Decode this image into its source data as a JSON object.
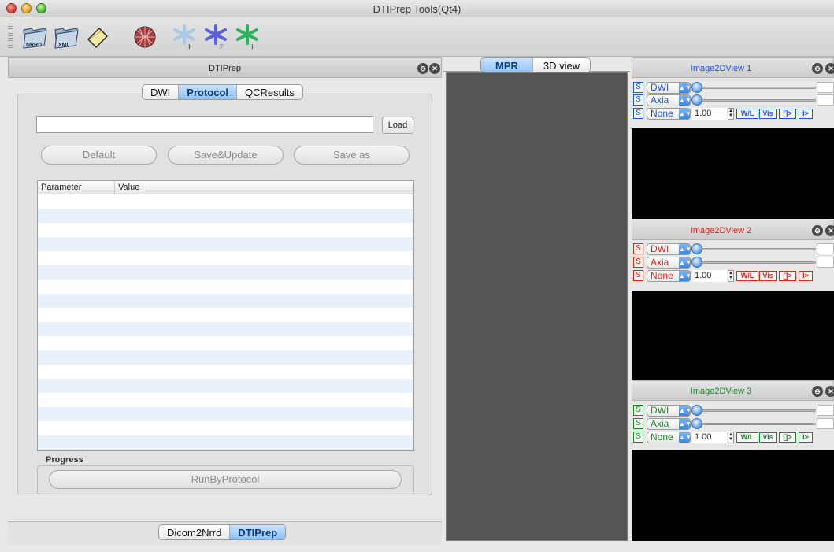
{
  "window": {
    "title": "DTIPrep Tools(Qt4)"
  },
  "toolbar": {
    "buttons": [
      {
        "icon": "folder-nrrd-icon",
        "label": "NRRD"
      },
      {
        "icon": "folder-xml-icon",
        "label": "XML"
      },
      {
        "icon": "eraser-icon"
      },
      {
        "icon": "sphere-mesh-icon"
      },
      {
        "icon": "star-p-icon",
        "label": "P"
      },
      {
        "icon": "star-f-icon",
        "label": "F"
      },
      {
        "icon": "star-i-icon",
        "label": "I"
      }
    ]
  },
  "left_dock": {
    "title": "DTIPrep",
    "tabs": [
      "DWI",
      "Protocol",
      "QCResults"
    ],
    "active_tab": "Protocol",
    "protocol_path": {
      "value": "",
      "placeholder": ""
    },
    "load_label": "Load",
    "default_label": "Default",
    "save_update_label": "Save&Update",
    "save_as_label": "Save as",
    "table": {
      "columns": [
        "Parameter",
        "Value"
      ],
      "rows": []
    },
    "progress_label": "Progress",
    "run_label": "RunByProtocol",
    "bottom_tabs": [
      "Dicom2Nrrd",
      "DTIPrep"
    ],
    "active_bottom_tab": "DTIPrep"
  },
  "center": {
    "tabs": [
      "MPR",
      "3D view"
    ],
    "active_tab": "MPR"
  },
  "views": [
    {
      "title": "Image2DView 1",
      "color": "#1f55d6",
      "combo1": "DWI",
      "combo2": "Axia",
      "combo3": "None",
      "zoom": "1.00",
      "wl": "W/L",
      "vis": "Vis",
      "b1": "[]>",
      "b2": "I>",
      "s": "S"
    },
    {
      "title": "Image2DView 2",
      "color": "#e0261c",
      "combo1": "DWI",
      "combo2": "Axia",
      "combo3": "None",
      "zoom": "1.00",
      "wl": "W/L",
      "vis": "Vis",
      "b1": "[]>",
      "b2": "I>",
      "s": "S"
    },
    {
      "title": "Image2DView 3",
      "color": "#1a8a2a",
      "combo1": "DWI",
      "combo2": "Axia",
      "combo3": "None",
      "zoom": "1.00",
      "wl": "W/L",
      "vis": "Vis",
      "b1": "[]>",
      "b2": "I>",
      "s": "S"
    }
  ]
}
